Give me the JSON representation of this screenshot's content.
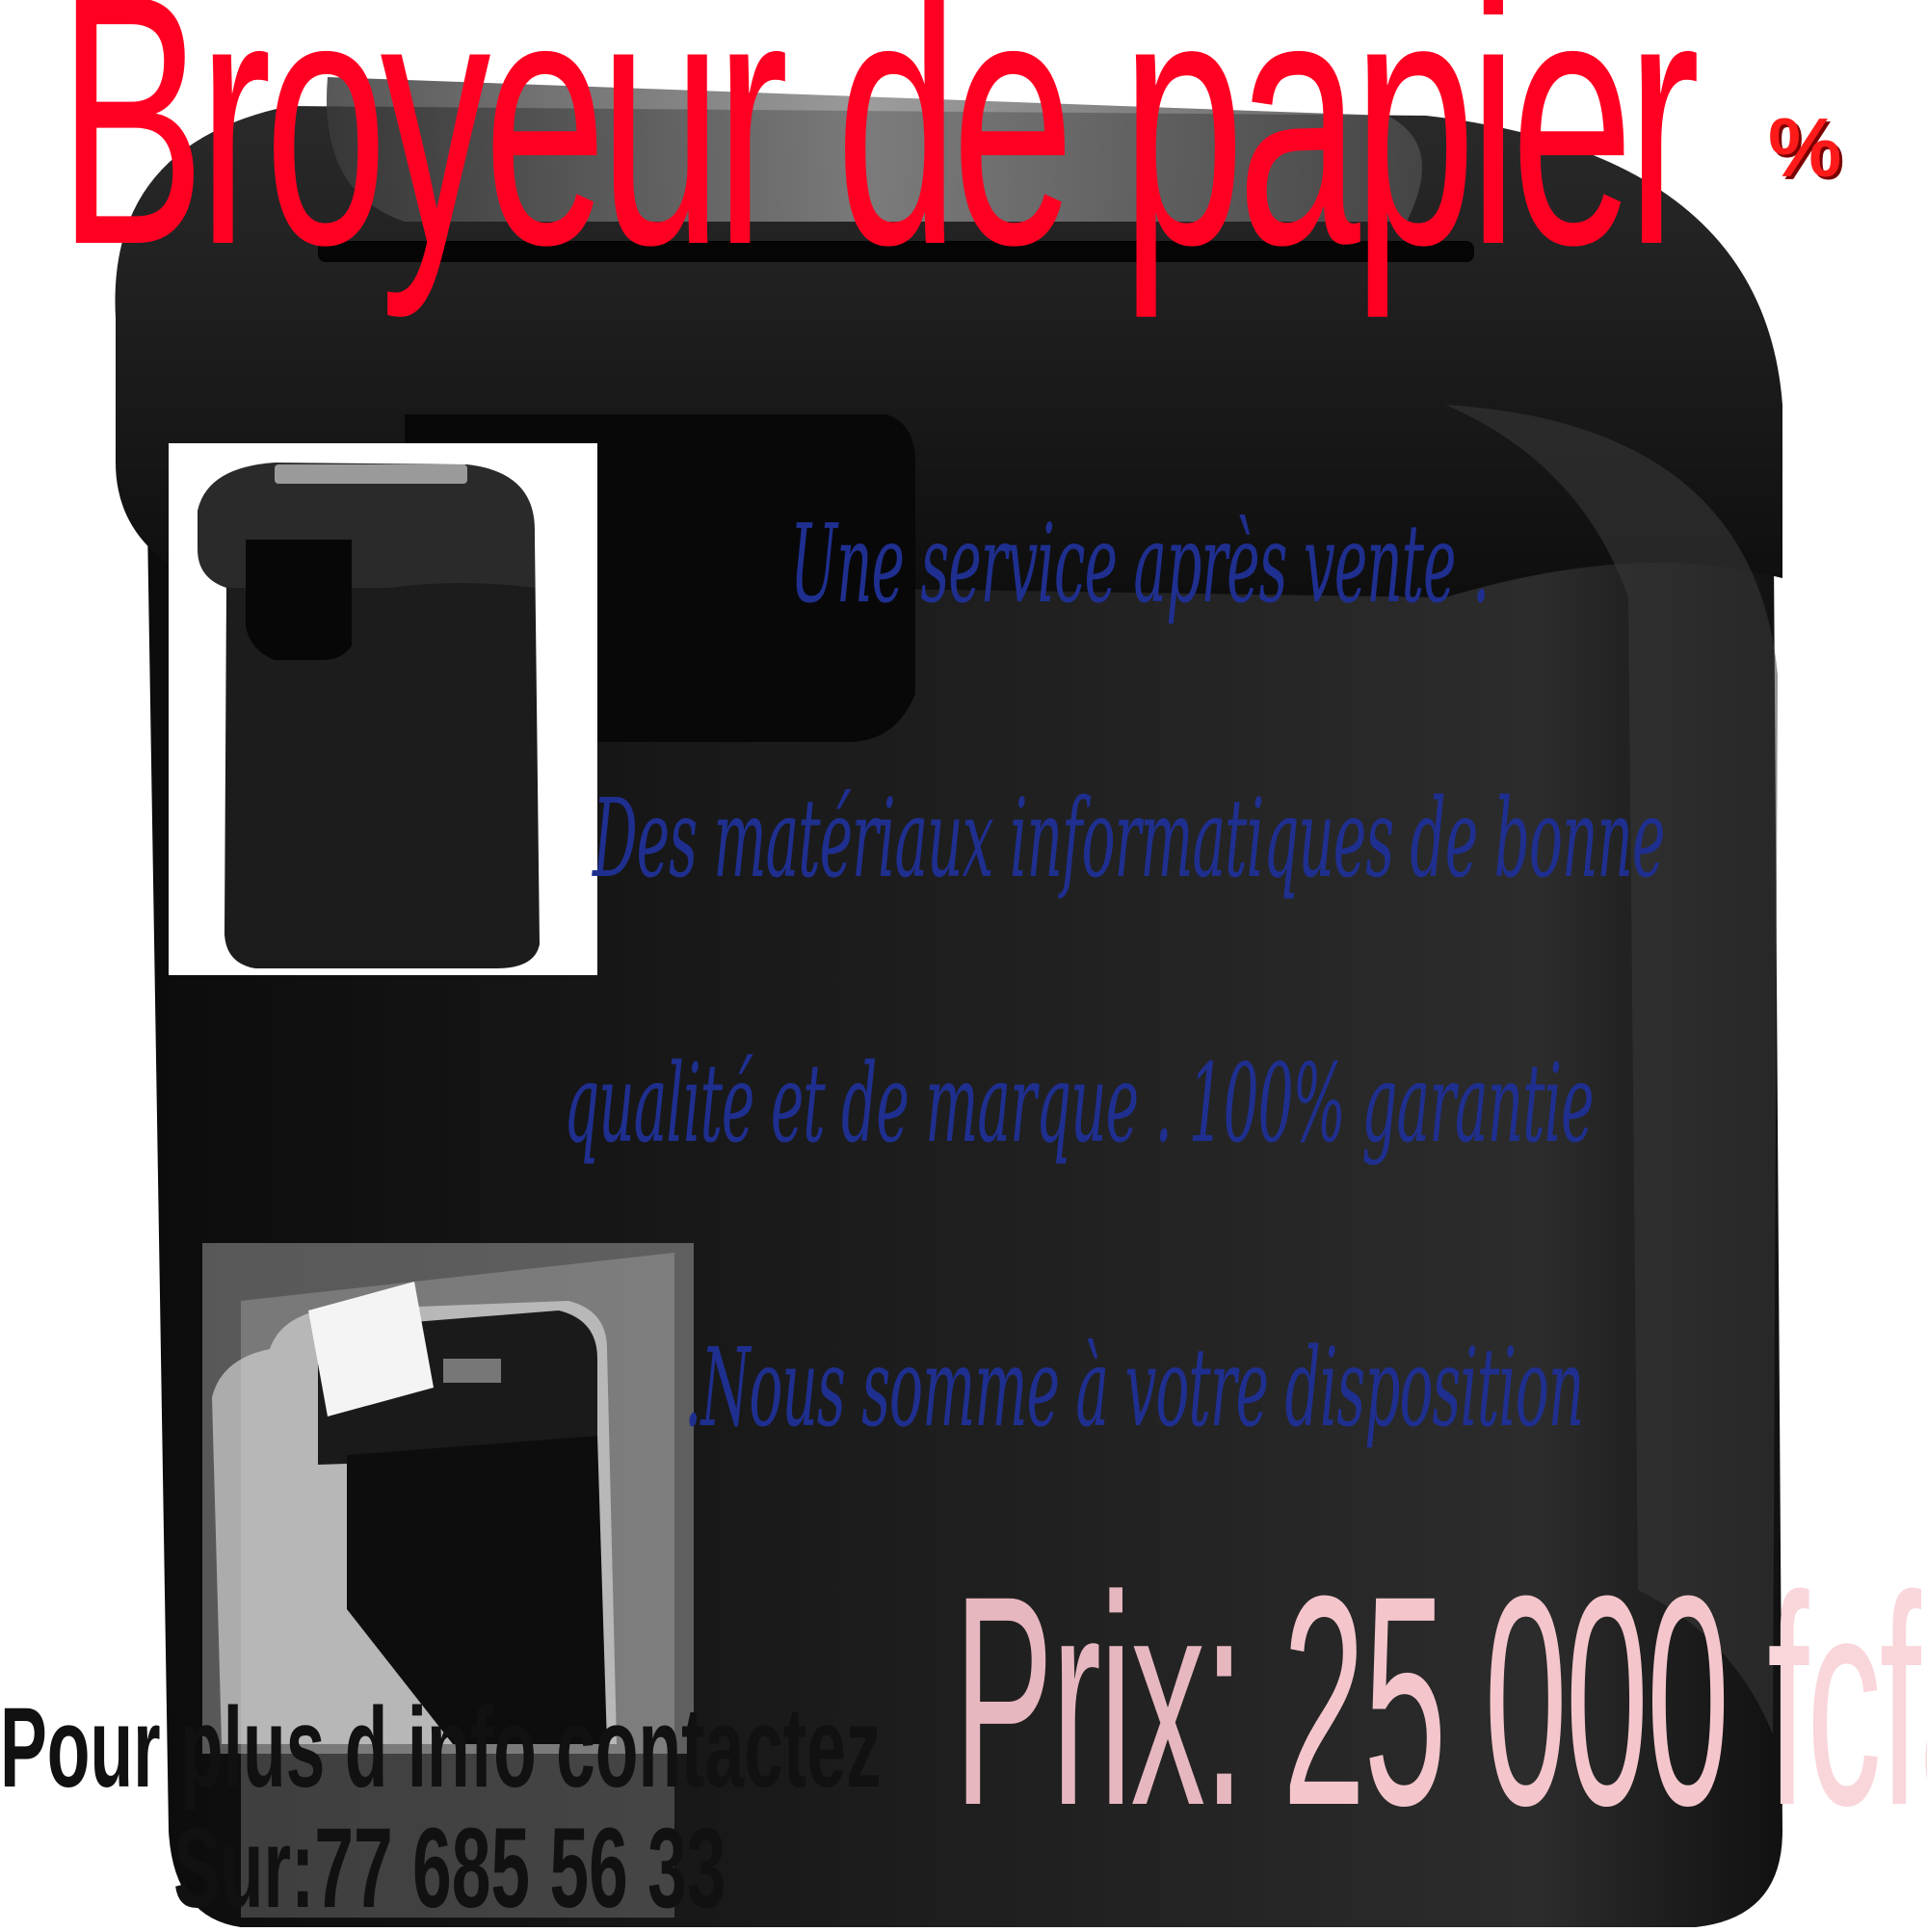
{
  "title": {
    "text": "Broyeur  de papier",
    "percent_symbol": "%"
  },
  "promo_lines": [
    "Une service après vente .",
    "Des matériaux informatiques  de bonne",
    "qualité et de marque . 100% garantie",
    ".Nous somme à votre disposition"
  ],
  "price": {
    "label": "Prix:",
    "amount": "25 000",
    "currency": "fcfa"
  },
  "contact": {
    "line1": "Pour plus d info contactez",
    "line2": "Sur:77 685 56 33"
  },
  "colors": {
    "title": "#ff0022",
    "promo": "#1f2f8f",
    "price_label": "#e7b7bf",
    "price_amount": "#f4c6cc",
    "contact": "#111111",
    "shredder": "#1a1a1a"
  }
}
